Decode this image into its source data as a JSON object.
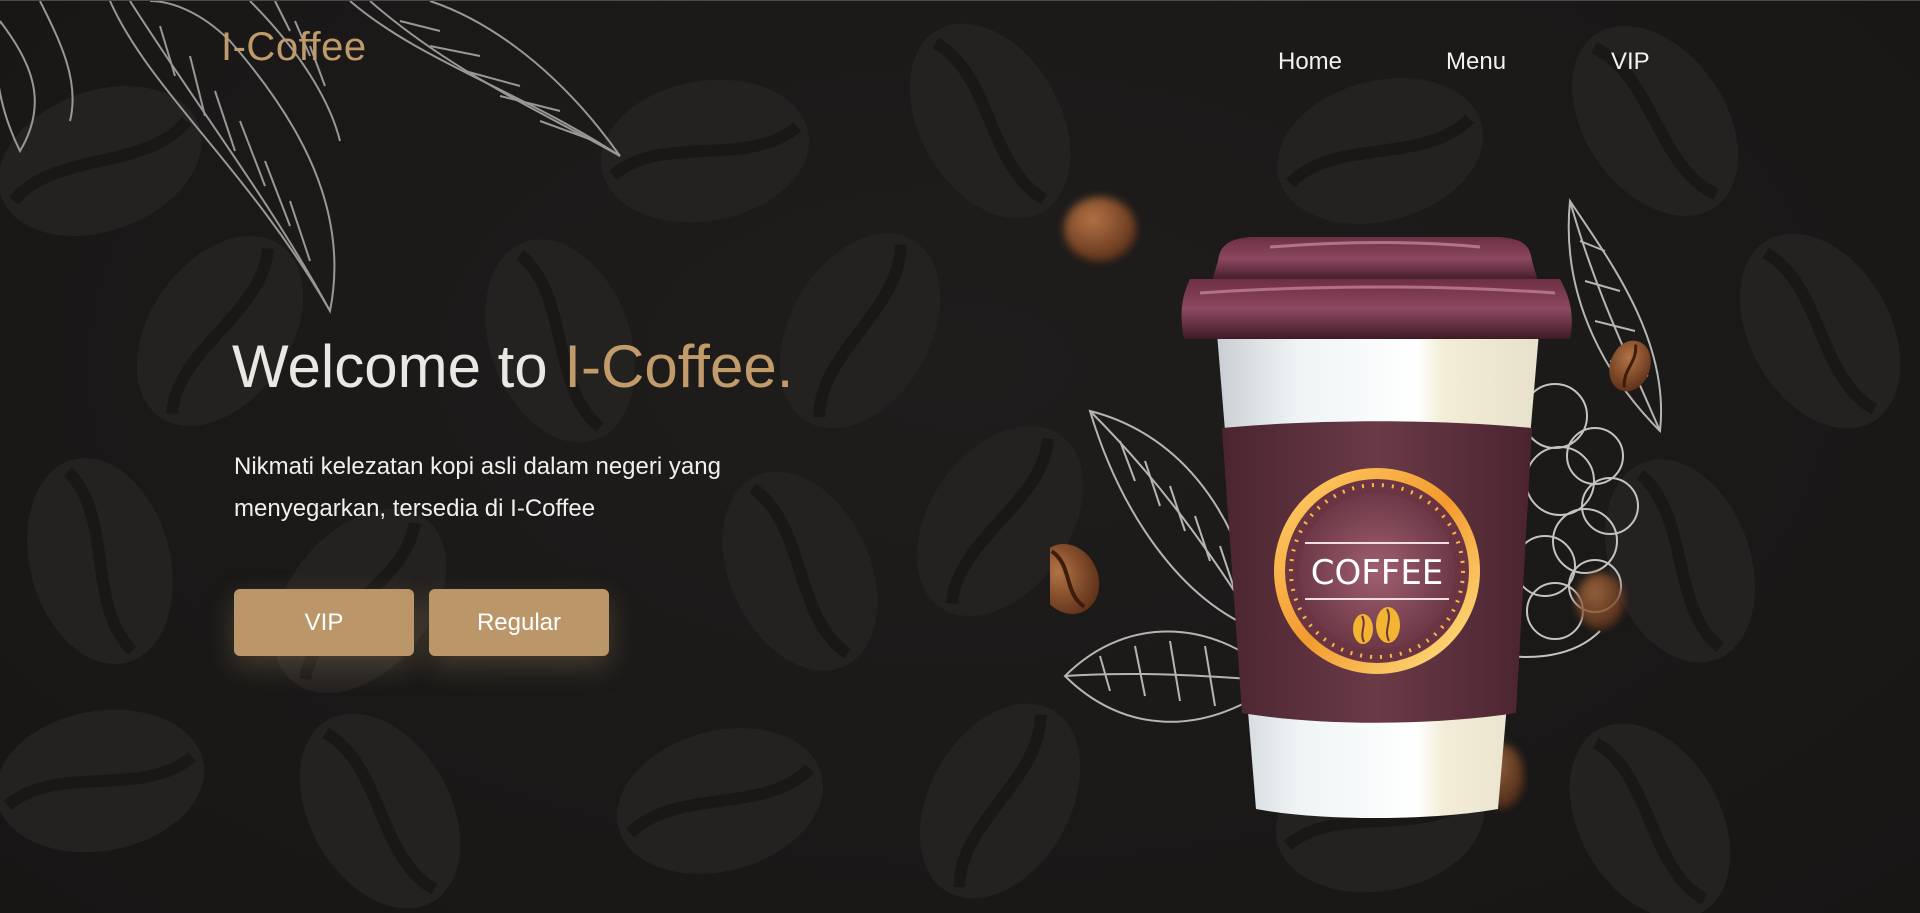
{
  "brand": {
    "logo": "I-Coffee"
  },
  "nav": {
    "home": "Home",
    "menu": "Menu",
    "vip": "VIP"
  },
  "hero": {
    "title_prefix": "Welcome to ",
    "title_accent": "I-Coffee.",
    "description": "Nikmati kelezatan kopi asli dalam negeri yang menyegarkan, tersedia di I-Coffee",
    "buttons": {
      "vip": "VIP",
      "regular": "Regular"
    }
  },
  "cup": {
    "label": "COFFEE"
  },
  "colors": {
    "background": "#1b1a19",
    "accent": "#c29b6b",
    "button": "#bb9669",
    "cup_sleeve": "#5a2d37",
    "text": "#f1f1f1"
  }
}
